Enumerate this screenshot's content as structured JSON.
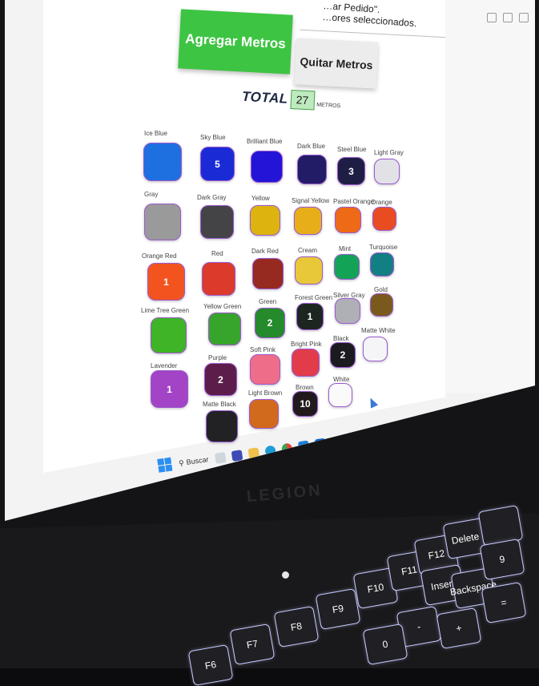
{
  "page": {
    "header_line1": "…ar Pedido\".",
    "header_line2": "…ores seleccionados."
  },
  "buttons": {
    "add_label": "Agregar Metros",
    "remove_label": "Quitar Metros"
  },
  "total": {
    "label": "TOTAL",
    "value": "27",
    "unit": "METROS"
  },
  "colors": {
    "accent_green": "#3ec443",
    "swatch_border": "#9b59d0",
    "total_field_bg": "#bfeac0"
  },
  "swatches": [
    {
      "name": "Ice Blue",
      "color": "#1e6fe0",
      "count": ""
    },
    {
      "name": "Sky Blue",
      "color": "#1a2bd6",
      "count": "5"
    },
    {
      "name": "Brilliant Blue",
      "color": "#2314d8",
      "count": ""
    },
    {
      "name": "Dark Blue",
      "color": "#221b66",
      "count": ""
    },
    {
      "name": "Steel Blue",
      "color": "#1e1e45",
      "count": "3"
    },
    {
      "name": "Light Gray",
      "color": "#e2e2e6",
      "count": ""
    },
    {
      "name": "Gray",
      "color": "#9a9a9a",
      "count": ""
    },
    {
      "name": "Dark Gray",
      "color": "#444447",
      "count": ""
    },
    {
      "name": "Yellow",
      "color": "#ddb40f",
      "count": ""
    },
    {
      "name": "Signal Yellow",
      "color": "#e8ae1a",
      "count": ""
    },
    {
      "name": "Pastel Orange",
      "color": "#ee6a17",
      "count": ""
    },
    {
      "name": "Orange",
      "color": "#e94c21",
      "count": ""
    },
    {
      "name": "Orange Red",
      "color": "#f3541f",
      "count": "1"
    },
    {
      "name": "Red",
      "color": "#dc3a2a",
      "count": ""
    },
    {
      "name": "Dark Red",
      "color": "#962a20",
      "count": ""
    },
    {
      "name": "Cream",
      "color": "#e8c838",
      "count": ""
    },
    {
      "name": "Mint",
      "color": "#13a356",
      "count": ""
    },
    {
      "name": "Turquoise",
      "color": "#127f82",
      "count": ""
    },
    {
      "name": "Lime Tree Green",
      "color": "#3eb426",
      "count": ""
    },
    {
      "name": "Yellow Green",
      "color": "#37a52b",
      "count": ""
    },
    {
      "name": "Green",
      "color": "#248a2c",
      "count": "2"
    },
    {
      "name": "Forest Green",
      "color": "#1c2520",
      "count": "1"
    },
    {
      "name": "Silver Gray",
      "color": "#aeb0b6",
      "count": ""
    },
    {
      "name": "Gold",
      "color": "#7a5a1c",
      "count": ""
    },
    {
      "name": "Lavender",
      "color": "#a343c6",
      "count": "1"
    },
    {
      "name": "Purple",
      "color": "#5c1d4a",
      "count": "2"
    },
    {
      "name": "Soft Pink",
      "color": "#ee6d88",
      "count": ""
    },
    {
      "name": "Bright Pink",
      "color": "#e23c4a",
      "count": ""
    },
    {
      "name": "Black",
      "color": "#1b1b1f",
      "count": "2"
    },
    {
      "name": "Matte White",
      "color": "#f5f5f7",
      "count": ""
    },
    {
      "name": "Matte Black",
      "color": "#222225",
      "count": ""
    },
    {
      "name": "Light Brown",
      "color": "#d26a1d",
      "count": ""
    },
    {
      "name": "Brown",
      "color": "#211a1d",
      "count": "10"
    },
    {
      "name": "White",
      "color": "#fafafa",
      "count": ""
    }
  ],
  "taskbar": {
    "search_label": "Buscar",
    "apps": [
      "start-icon",
      "search-icon",
      "files-icon",
      "meet-icon",
      "folder-icon",
      "edge-icon",
      "chrome-icon",
      "vscode-icon",
      "store-icon"
    ]
  },
  "laptop": {
    "brand": "LEGION"
  },
  "keyboard": {
    "keys": [
      "F6",
      "F7",
      "F8",
      "F9",
      "F10",
      "F11",
      "F12",
      "Delete",
      "",
      "Insert",
      "Backspace",
      "-",
      "0",
      "9",
      "+",
      "="
    ]
  }
}
